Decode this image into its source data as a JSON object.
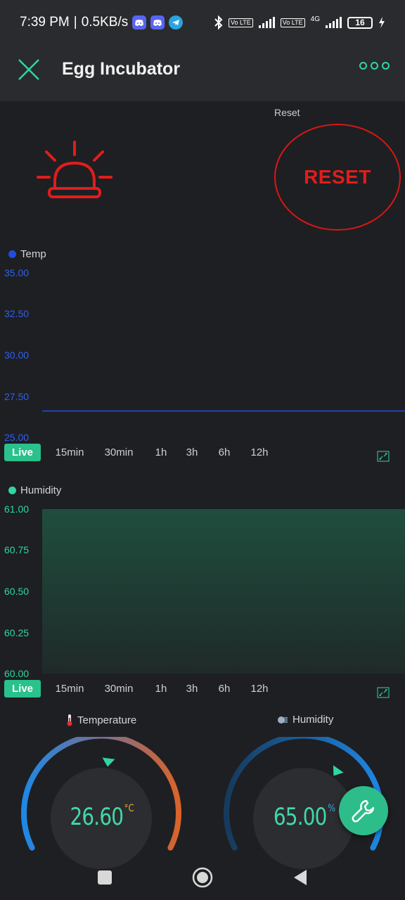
{
  "status_bar": {
    "time": "7:39 PM",
    "separator": "|",
    "speed": "0.5KB/s",
    "battery": "16",
    "network": "4G",
    "volte": "Vo LTE"
  },
  "app_bar": {
    "title": "Egg Incubator"
  },
  "reset": {
    "label": "Reset",
    "button": "RESET"
  },
  "temp_chart": {
    "legend": "Temp",
    "yticks": [
      "35.00",
      "32.50",
      "30.00",
      "27.50",
      "25.00"
    ],
    "tabs": [
      "Live",
      "15min",
      "30min",
      "1h",
      "3h",
      "6h",
      "12h"
    ]
  },
  "humidity_chart": {
    "legend": "Humidity",
    "yticks": [
      "61.00",
      "60.75",
      "60.50",
      "60.25",
      "60.00"
    ],
    "tabs": [
      "Live",
      "15min",
      "30min",
      "1h",
      "3h",
      "6h",
      "12h"
    ]
  },
  "chart_data": [
    {
      "type": "line",
      "series": [
        {
          "name": "Temp",
          "x": [
            0,
            1
          ],
          "y": [
            26.6,
            26.6
          ]
        }
      ],
      "ylim": [
        25,
        35
      ],
      "legend": "top-left",
      "color": "#1e4ee0"
    },
    {
      "type": "area",
      "series": [
        {
          "name": "Humidity",
          "x": [
            0,
            1
          ],
          "y": [
            61.0,
            61.0
          ]
        }
      ],
      "ylim": [
        60,
        61
      ],
      "legend": "top-left",
      "color": "#2fd6a1"
    }
  ],
  "gauges": {
    "temperature": {
      "title": "Temperature",
      "value": "26.60",
      "unit": "°C",
      "level": 0.53
    },
    "humidity": {
      "title": "Humidity",
      "value": "65.00",
      "unit": "%",
      "level": 0.65
    }
  },
  "colors": {
    "accent": "#2fd6a1",
    "alert": "#e01d1d",
    "temp_line": "#1e4ee0",
    "background": "#1e1f22"
  }
}
